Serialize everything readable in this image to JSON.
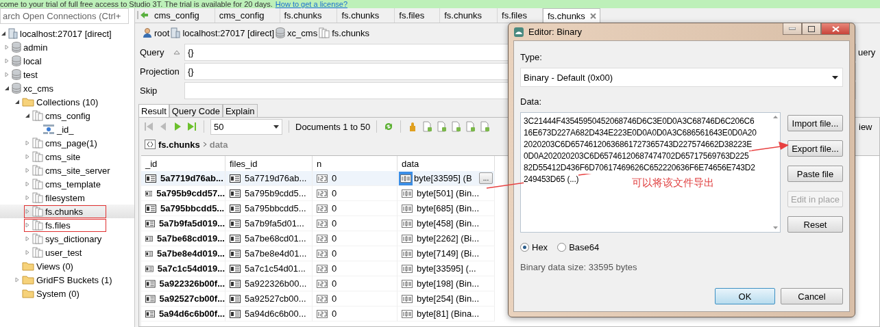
{
  "banner": {
    "text": "come to your trial of full free access to Studio 3T. The trial is available for 20 days.",
    "link": "How to get a license?"
  },
  "sidebar": {
    "search": {
      "placeholder": "arch Open Connections (Ctrl+"
    },
    "tree": [
      {
        "label": "localhost:27017 [direct]",
        "kind": "server",
        "expanded": true,
        "selected": false,
        "marked": false,
        "children": [
          {
            "label": "admin",
            "kind": "database",
            "expanded": false,
            "selected": false,
            "marked": false
          },
          {
            "label": "local",
            "kind": "database",
            "expanded": false,
            "selected": false,
            "marked": false
          },
          {
            "label": "test",
            "kind": "database",
            "expanded": false,
            "selected": false,
            "marked": false
          },
          {
            "label": "xc_cms",
            "kind": "database",
            "expanded": true,
            "selected": false,
            "marked": false,
            "children": [
              {
                "label": "Collections (10)",
                "kind": "folder",
                "expanded": true,
                "selected": false,
                "marked": false,
                "children": [
                  {
                    "label": "cms_config",
                    "kind": "collection",
                    "expanded": true,
                    "selected": false,
                    "marked": false,
                    "children": [
                      {
                        "label": "_id_",
                        "kind": "index",
                        "selected": false,
                        "marked": false
                      }
                    ]
                  },
                  {
                    "label": "cms_page(1)",
                    "kind": "collection",
                    "expanded": false,
                    "selected": false,
                    "marked": false
                  },
                  {
                    "label": "cms_site",
                    "kind": "collection",
                    "expanded": false,
                    "selected": false,
                    "marked": false
                  },
                  {
                    "label": "cms_site_server",
                    "kind": "collection",
                    "expanded": false,
                    "selected": false,
                    "marked": false
                  },
                  {
                    "label": "cms_template",
                    "kind": "collection",
                    "expanded": false,
                    "selected": false,
                    "marked": false
                  },
                  {
                    "label": "filesystem",
                    "kind": "collection",
                    "expanded": false,
                    "selected": false,
                    "marked": false
                  },
                  {
                    "label": "fs.chunks",
                    "kind": "collection",
                    "expanded": false,
                    "selected": true,
                    "marked": true
                  },
                  {
                    "label": "fs.files",
                    "kind": "collection",
                    "expanded": false,
                    "selected": false,
                    "marked": true
                  },
                  {
                    "label": "sys_dictionary",
                    "kind": "collection",
                    "expanded": false,
                    "selected": false,
                    "marked": false
                  },
                  {
                    "label": "user_test",
                    "kind": "collection",
                    "expanded": false,
                    "selected": false,
                    "marked": false
                  }
                ]
              },
              {
                "label": "Views (0)",
                "kind": "folder",
                "selected": false,
                "marked": false
              },
              {
                "label": "GridFS Buckets (1)",
                "kind": "folder",
                "expanded": false,
                "selected": false,
                "marked": false
              },
              {
                "label": "System (0)",
                "kind": "folder",
                "selected": false,
                "marked": false
              }
            ]
          }
        ]
      }
    ]
  },
  "tabs": [
    {
      "label": "cms_config",
      "selected": false
    },
    {
      "label": "cms_config",
      "selected": false
    },
    {
      "label": "fs.chunks",
      "selected": false
    },
    {
      "label": "fs.chunks",
      "selected": false
    },
    {
      "label": "fs.files",
      "selected": false
    },
    {
      "label": "fs.chunks",
      "selected": false
    },
    {
      "label": "fs.files",
      "selected": false
    },
    {
      "label": "fs.chunks",
      "selected": true
    }
  ],
  "breadcrumb": [
    {
      "label": "root",
      "kind": "user"
    },
    {
      "label": "localhost:27017 [direct]",
      "kind": "server"
    },
    {
      "label": "xc_cms",
      "kind": "database"
    },
    {
      "label": "fs.chunks",
      "kind": "collection"
    }
  ],
  "query_fields": [
    {
      "label": "Query",
      "value": "{}",
      "sortable": true
    },
    {
      "label": "Projection",
      "value": "{}",
      "sortable": false
    },
    {
      "label": "Skip",
      "sortable": false
    }
  ],
  "query_button": "uery",
  "result_tabs": [
    {
      "label": "Result",
      "selected": true
    },
    {
      "label": "Query Code",
      "selected": false
    },
    {
      "label": "Explain",
      "selected": false
    }
  ],
  "toolbar": {
    "page_size": "50",
    "documents": "Documents 1 to 50",
    "view_button": "iew"
  },
  "path": {
    "collection": "fs.chunks",
    "field": "data"
  },
  "table": {
    "columns": [
      "_id",
      "files_id",
      "n",
      "data"
    ],
    "rows": [
      {
        "id": "5a7719d76ab...",
        "files_id": "5a7719d76ab...",
        "n": "0",
        "data": "byte[33595] (B",
        "selected": true
      },
      {
        "id": "5a795b9cdd57...",
        "files_id": "5a795b9cdd5...",
        "n": "0",
        "data": "byte[501] (Bin...",
        "selected": false
      },
      {
        "id": "5a795bbcdd5...",
        "files_id": "5a795bbcdd5...",
        "n": "0",
        "data": "byte[685] (Bin...",
        "selected": false
      },
      {
        "id": "5a7b9fa5d019...",
        "files_id": "5a7b9fa5d01...",
        "n": "0",
        "data": "byte[458] (Bin...",
        "selected": false
      },
      {
        "id": "5a7be68cd019...",
        "files_id": "5a7be68cd01...",
        "n": "0",
        "data": "byte[2262] (Bi...",
        "selected": false
      },
      {
        "id": "5a7be8e4d019...",
        "files_id": "5a7be8e4d01...",
        "n": "0",
        "data": "byte[7149] (Bi...",
        "selected": false
      },
      {
        "id": "5a7c1c54d019...",
        "files_id": "5a7c1c54d01...",
        "n": "0",
        "data": "byte[33595] (...",
        "selected": false
      },
      {
        "id": "5a922326b00f...",
        "files_id": "5a922326b00...",
        "n": "0",
        "data": "byte[198] (Bin...",
        "selected": false
      },
      {
        "id": "5a92527cb00f...",
        "files_id": "5a92527cb00...",
        "n": "0",
        "data": "byte[254] (Bin...",
        "selected": false
      },
      {
        "id": "5a94d6c6b00f...",
        "files_id": "5a94d6c6b00...",
        "n": "0",
        "data": "byte[81] (Bina...",
        "selected": false
      }
    ],
    "more_button": "..."
  },
  "dialog": {
    "title": "Editor: Binary",
    "type_label": "Type:",
    "type_value": "Binary - Default (0x00)",
    "data_label": "Data:",
    "data_lines": [
      "3C21444F43545950452068746D6C3E0D0A3C68746D6C206C6",
      "16E673D227A682D434E223E0D0A0D0A3C686561643E0D0A20",
      "2020203C6D65746120636861727365743D227574662D38223E",
      "0D0A202020203C6D65746120687474702D65717569763D225",
      "82D55412D436F6D70617469626C652220636F6E74656E743D2",
      "249453D65 (...)"
    ],
    "side_buttons": [
      {
        "label": "Import file...",
        "disabled": false
      },
      {
        "label": "Export file...",
        "disabled": false
      },
      {
        "label": "Paste file",
        "disabled": false
      },
      {
        "label": "Edit in place",
        "disabled": true
      },
      {
        "label": "Reset",
        "disabled": false
      }
    ],
    "encodings": [
      {
        "label": "Hex",
        "selected": true
      },
      {
        "label": "Base64",
        "selected": false
      }
    ],
    "size_text": "Binary data size: 33595 bytes",
    "ok": "OK",
    "cancel": "Cancel"
  },
  "annotation": {
    "text": "可以将该文件导出"
  }
}
